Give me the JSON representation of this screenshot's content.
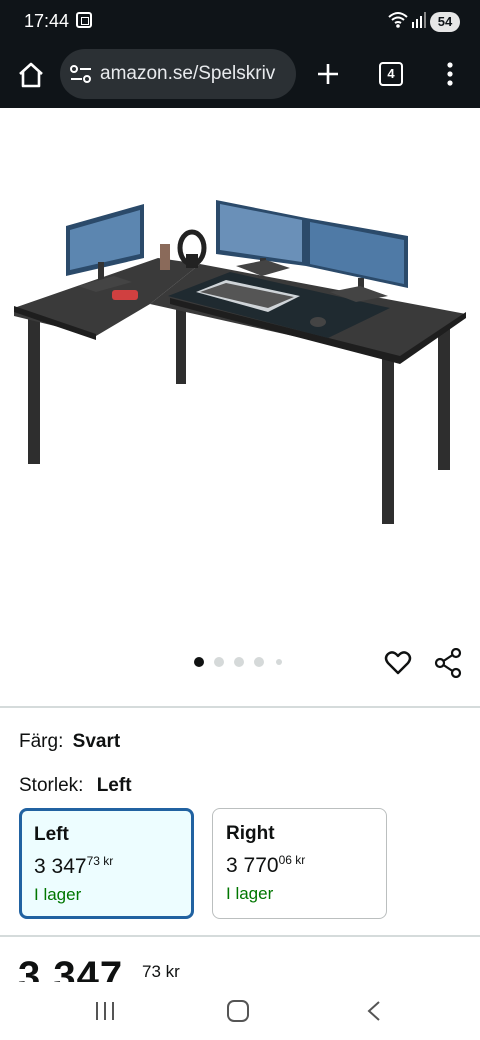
{
  "status_bar": {
    "time": "17:44",
    "battery": "54",
    "icons": [
      "screenshot-icon",
      "wifi-icon",
      "signal-icon",
      "battery-icon"
    ]
  },
  "browser": {
    "url": "amazon.se/Spelskriv",
    "tab_count": "4",
    "icons": [
      "home-icon",
      "site-settings-icon",
      "plus-icon",
      "tabs-icon",
      "more-vertical-icon"
    ]
  },
  "gallery": {
    "image_alt": "L-shaped gaming desk with monitors, keyboard and headphones",
    "dot_count": 5,
    "active_index": 0,
    "icons": [
      "heart-icon",
      "share-icon"
    ]
  },
  "color": {
    "label": "Färg:",
    "value": "Svart"
  },
  "size": {
    "label": "Storlek:",
    "value": "Left",
    "options": [
      {
        "name": "Left",
        "price_whole": "3 347",
        "price_fraction": "73",
        "currency": "kr",
        "stock": "I lager",
        "selected": true
      },
      {
        "name": "Right",
        "price_whole": "3 770",
        "price_fraction": "06",
        "currency": "kr",
        "stock": "I lager",
        "selected": false
      }
    ]
  },
  "price": {
    "whole": "3 347",
    "fraction": "73",
    "currency": "kr"
  },
  "colors": {
    "selected_border": "#2162a1",
    "selected_bg": "#edfdff",
    "stock_green": "#007600",
    "bar_dark": "#0f1418"
  },
  "nav_bar": {
    "icons": [
      "recents-icon",
      "home-nav-icon",
      "back-icon"
    ]
  }
}
